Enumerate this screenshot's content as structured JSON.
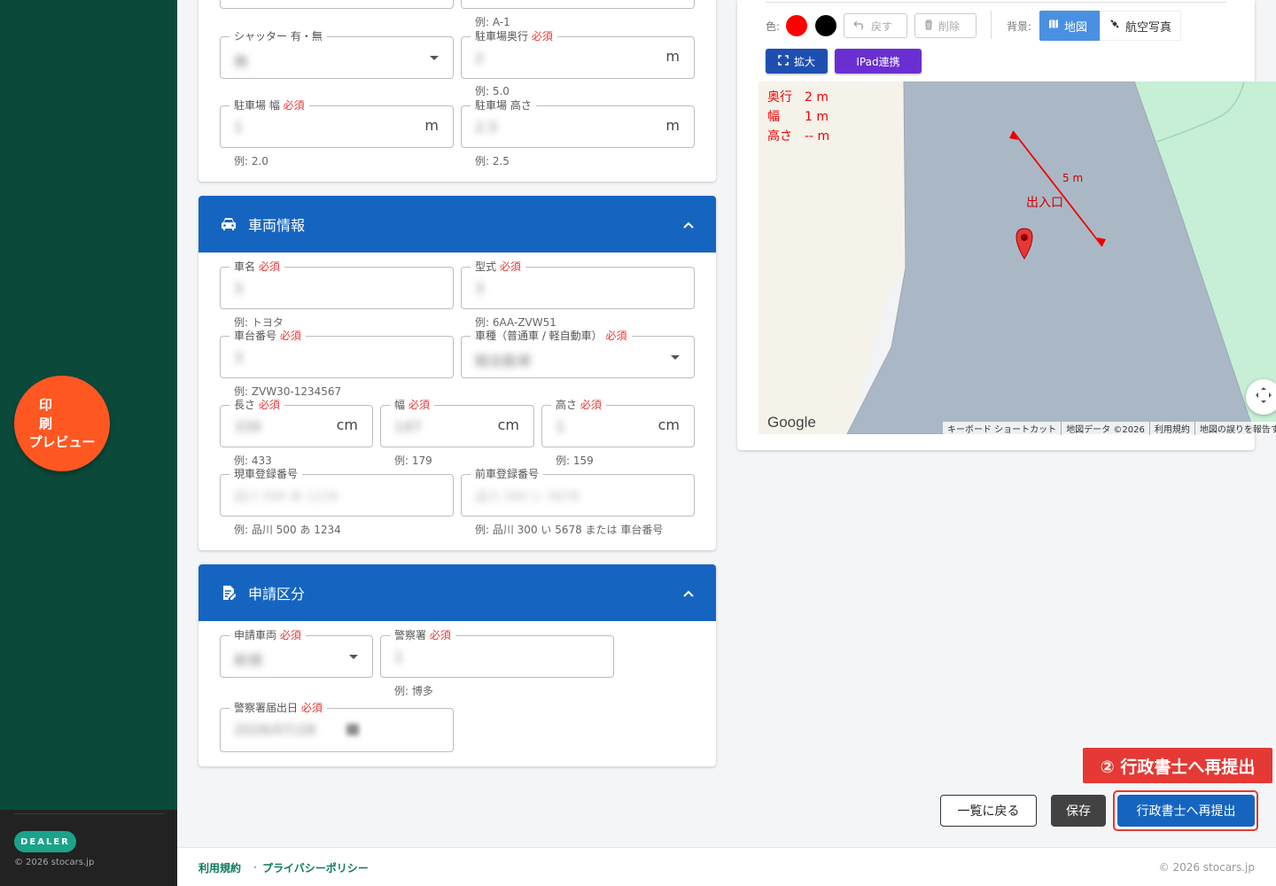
{
  "sidebar": {
    "print_line1": "印刷",
    "print_line2": "プレビュー",
    "badge": "DEALER",
    "copyright": "© 2026 stocars.jp"
  },
  "parking": {
    "hint_top": "例: A-1",
    "shutter_label": "シャッター 有・無",
    "shutter_value": "無",
    "depth_label": "駐車場奥行",
    "depth_value": "2",
    "depth_unit": "m",
    "depth_hint": "例: 5.0",
    "width_label": "駐車場 幅",
    "width_value": "1",
    "width_unit": "m",
    "width_hint": "例: 2.0",
    "height_label": "駐車場 高さ",
    "height_value": "2.5",
    "height_unit": "m",
    "height_hint": "例: 2.5"
  },
  "vehicle": {
    "title": "車両情報",
    "name_label": "車名",
    "name_value": "3",
    "name_hint": "例: トヨタ",
    "model_label": "型式",
    "model_value": "3",
    "model_hint": "例: 6AA-ZVW51",
    "chassis_label": "車台番号",
    "chassis_value": "3",
    "chassis_hint": "例: ZVW30-1234567",
    "type_label": "車種（普通車 / 軽自動車）",
    "type_value": "軽自動車",
    "length_label": "長さ",
    "length_value": "339",
    "length_unit": "cm",
    "length_hint": "例: 433",
    "vwidth_label": "幅",
    "vwidth_value": "147",
    "vwidth_unit": "cm",
    "vwidth_hint": "例: 179",
    "vheight_label": "高さ",
    "vheight_value": "1",
    "vheight_unit": "cm",
    "vheight_hint": "例: 159",
    "current_reg_label": "現車登録番号",
    "current_reg_placeholder": "品川 500 あ 1234",
    "current_reg_hint": "例: 品川 500 あ 1234",
    "prev_reg_label": "前車登録番号",
    "prev_reg_placeholder": "品川 300 い 5678",
    "prev_reg_hint": "例: 品川 300 い 5678 または 車台番号"
  },
  "application": {
    "title": "申請区分",
    "vehicle_label": "申請車両",
    "vehicle_value": "新規",
    "police_label": "警察署",
    "police_value": "1",
    "police_hint": "例: 博多",
    "date_label": "警察署届出日",
    "date_value": "2026/07/28"
  },
  "required_mark": "必須",
  "map_panel": {
    "color_label": "色:",
    "colors": [
      "#ff0000",
      "#000000"
    ],
    "undo_label": "戻す",
    "delete_label": "削除",
    "bg_label": "背景:",
    "map_label": "地図",
    "aerial_label": "航空写真",
    "expand_label": "拡大",
    "ipad_label": "IPad連携",
    "measure_depth": "奥行　2 m",
    "measure_width": "幅　　1 m",
    "measure_height": "高さ　-- m",
    "arrow_label": "5 m",
    "entrance_label": "出入口",
    "google": "Google",
    "footer_shortcuts": "キーボード ショートカット",
    "footer_data": "地図データ ©2026",
    "footer_terms": "利用規約",
    "footer_report": "地図の誤りを報告す"
  },
  "actions": {
    "callout": "② 行政書士へ再提出",
    "back": "一覧に戻る",
    "save": "保存",
    "resubmit": "行政書士へ再提出"
  },
  "footer": {
    "terms": "利用規約",
    "separator": "・",
    "privacy": "プライバシーポリシー",
    "copyright": "© 2026 stocars.jp"
  }
}
